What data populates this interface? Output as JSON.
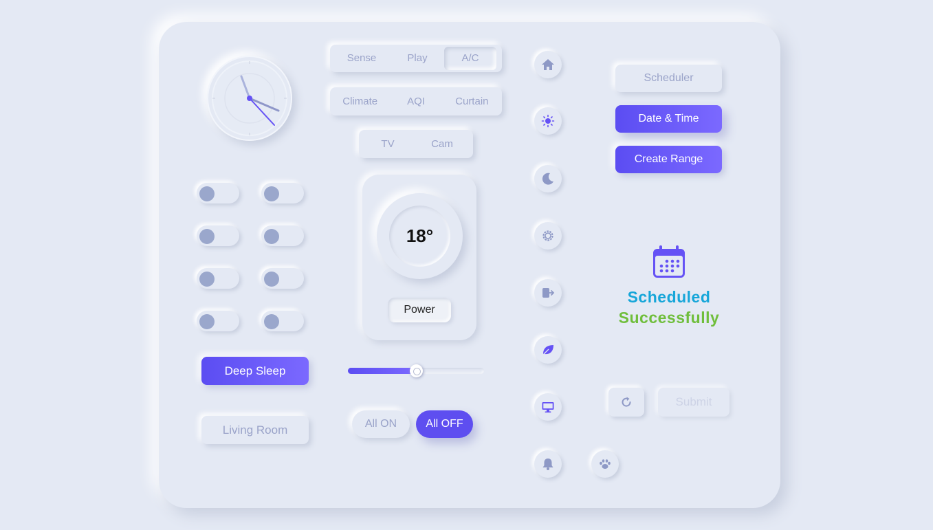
{
  "colors": {
    "background": "#e4e9f4",
    "accent": "#6552f5",
    "muted_text": "#9aa3c9",
    "status_scheduled": "#16a6d9",
    "status_success": "#6fbe3b"
  },
  "clock": {
    "hour_hand": "~3:50",
    "icon": "analog-clock"
  },
  "tabs_row1": [
    {
      "label": "Sense",
      "active": false
    },
    {
      "label": "Play",
      "active": false
    },
    {
      "label": "A/C",
      "active": true
    }
  ],
  "tabs_row2": [
    {
      "label": "Climate"
    },
    {
      "label": "AQI"
    },
    {
      "label": "Curtain"
    }
  ],
  "tabs_row3": [
    {
      "label": "TV"
    },
    {
      "label": "Cam"
    }
  ],
  "toggles": [
    {
      "on": false
    },
    {
      "on": false
    },
    {
      "on": false
    },
    {
      "on": false
    },
    {
      "on": false
    },
    {
      "on": false
    },
    {
      "on": false
    },
    {
      "on": false
    }
  ],
  "left_buttons": {
    "deep_sleep": "Deep Sleep",
    "living_room": "Living Room"
  },
  "thermostat": {
    "temperature": "18°",
    "power_label": "Power"
  },
  "slider": {
    "value_percent": 50
  },
  "all_switch": {
    "on_label": "All ON",
    "off_label": "All OFF",
    "selected": "All OFF"
  },
  "icon_buttons": [
    "home-icon",
    "sun-icon",
    "moon-icon",
    "gear-icon",
    "logout-icon",
    "leaf-icon",
    "monitor-icon",
    "bell-icon",
    "paw-icon"
  ],
  "right_buttons": {
    "scheduler": "Scheduler",
    "date_time": "Date & Time",
    "create_range": "Create Range",
    "submit": "Submit"
  },
  "status": {
    "line1": "Scheduled",
    "line2": "Successfully",
    "icon": "calendar-icon"
  }
}
